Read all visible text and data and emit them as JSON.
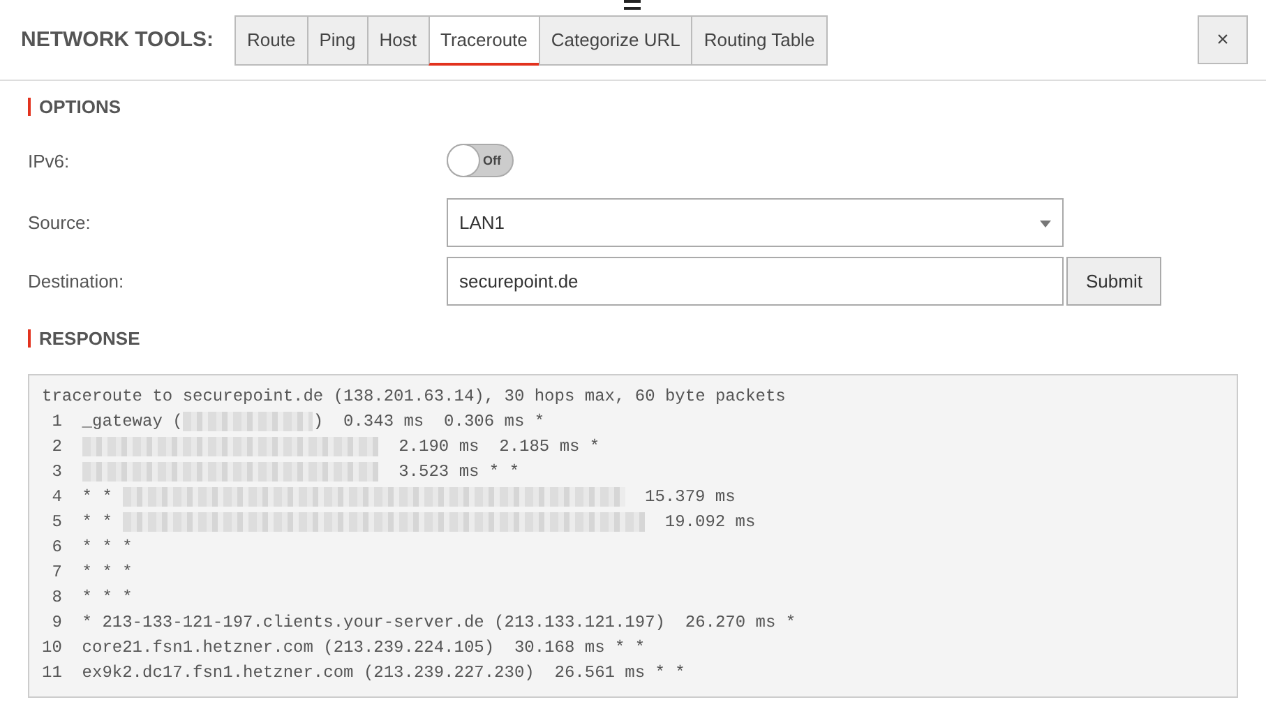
{
  "header": {
    "title": "NETWORK TOOLS:",
    "tabs": [
      {
        "label": "Route",
        "selected": false
      },
      {
        "label": "Ping",
        "selected": false
      },
      {
        "label": "Host",
        "selected": false
      },
      {
        "label": "Traceroute",
        "selected": true
      },
      {
        "label": "Categorize URL",
        "selected": false
      },
      {
        "label": "Routing Table",
        "selected": false
      }
    ],
    "close": "×"
  },
  "options": {
    "heading": "OPTIONS",
    "fields": [
      {
        "kind": "toggle",
        "label": "IPv6:",
        "on": false,
        "state_text": "Off"
      },
      {
        "kind": "select",
        "label": "Source:",
        "value": "LAN1"
      },
      {
        "kind": "input",
        "label": "Destination:",
        "value": "securepoint.de",
        "button": "Submit"
      }
    ]
  },
  "response": {
    "heading": "RESPONSE",
    "lines": [
      {
        "parts": [
          {
            "kind": "text",
            "text": "traceroute to securepoint.de (138.201.63.14), 30 hops max, 60 byte packets"
          }
        ]
      },
      {
        "parts": [
          {
            "kind": "text",
            "text": " 1  _gateway ("
          },
          {
            "kind": "redacted"
          },
          {
            "kind": "text",
            "text": ")  0.343 ms  0.306 ms *"
          }
        ]
      },
      {
        "parts": [
          {
            "kind": "text",
            "text": " 2  "
          },
          {
            "kind": "redacted"
          },
          {
            "kind": "text",
            "text": "  2.190 ms  2.185 ms *"
          }
        ]
      },
      {
        "parts": [
          {
            "kind": "text",
            "text": " 3  "
          },
          {
            "kind": "redacted"
          },
          {
            "kind": "text",
            "text": "  3.523 ms * *"
          }
        ]
      },
      {
        "parts": [
          {
            "kind": "text",
            "text": " 4  * * "
          },
          {
            "kind": "redacted"
          },
          {
            "kind": "text",
            "text": "  15.379 ms"
          }
        ]
      },
      {
        "parts": [
          {
            "kind": "text",
            "text": " 5  * * "
          },
          {
            "kind": "redacted"
          },
          {
            "kind": "text",
            "text": "  19.092 ms"
          }
        ]
      },
      {
        "parts": [
          {
            "kind": "text",
            "text": " 6  * * *"
          }
        ]
      },
      {
        "parts": [
          {
            "kind": "text",
            "text": " 7  * * *"
          }
        ]
      },
      {
        "parts": [
          {
            "kind": "text",
            "text": " 8  * * *"
          }
        ]
      },
      {
        "parts": [
          {
            "kind": "text",
            "text": " 9  * 213-133-121-197.clients.your-server.de (213.133.121.197)  26.270 ms *"
          }
        ]
      },
      {
        "parts": [
          {
            "kind": "text",
            "text": "10  core21.fsn1.hetzner.com (213.239.224.105)  30.168 ms * *"
          }
        ]
      },
      {
        "parts": [
          {
            "kind": "text",
            "text": "11  ex9k2.dc17.fsn1.hetzner.com (213.239.227.230)  26.561 ms * *"
          }
        ]
      }
    ]
  }
}
